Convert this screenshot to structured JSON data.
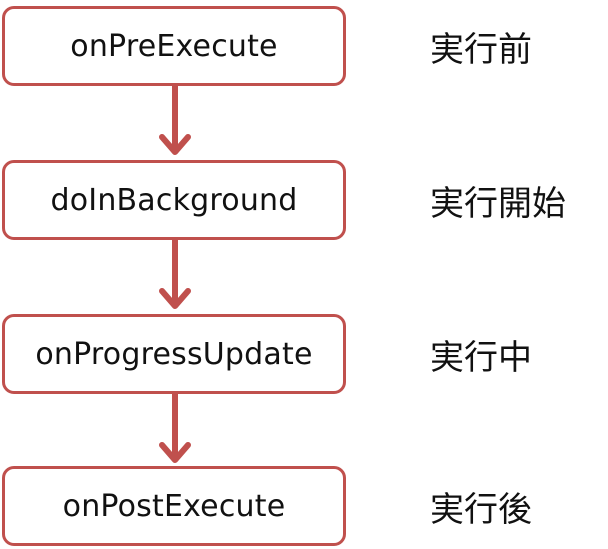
{
  "diagram": {
    "accent_color": "#c0504d",
    "steps": [
      {
        "method": "onPreExecute",
        "state": "実行前"
      },
      {
        "method": "doInBackground",
        "state": "実行開始"
      },
      {
        "method": "onProgressUpdate",
        "state": "実行中"
      },
      {
        "method": "onPostExecute",
        "state": "実行後"
      }
    ]
  }
}
